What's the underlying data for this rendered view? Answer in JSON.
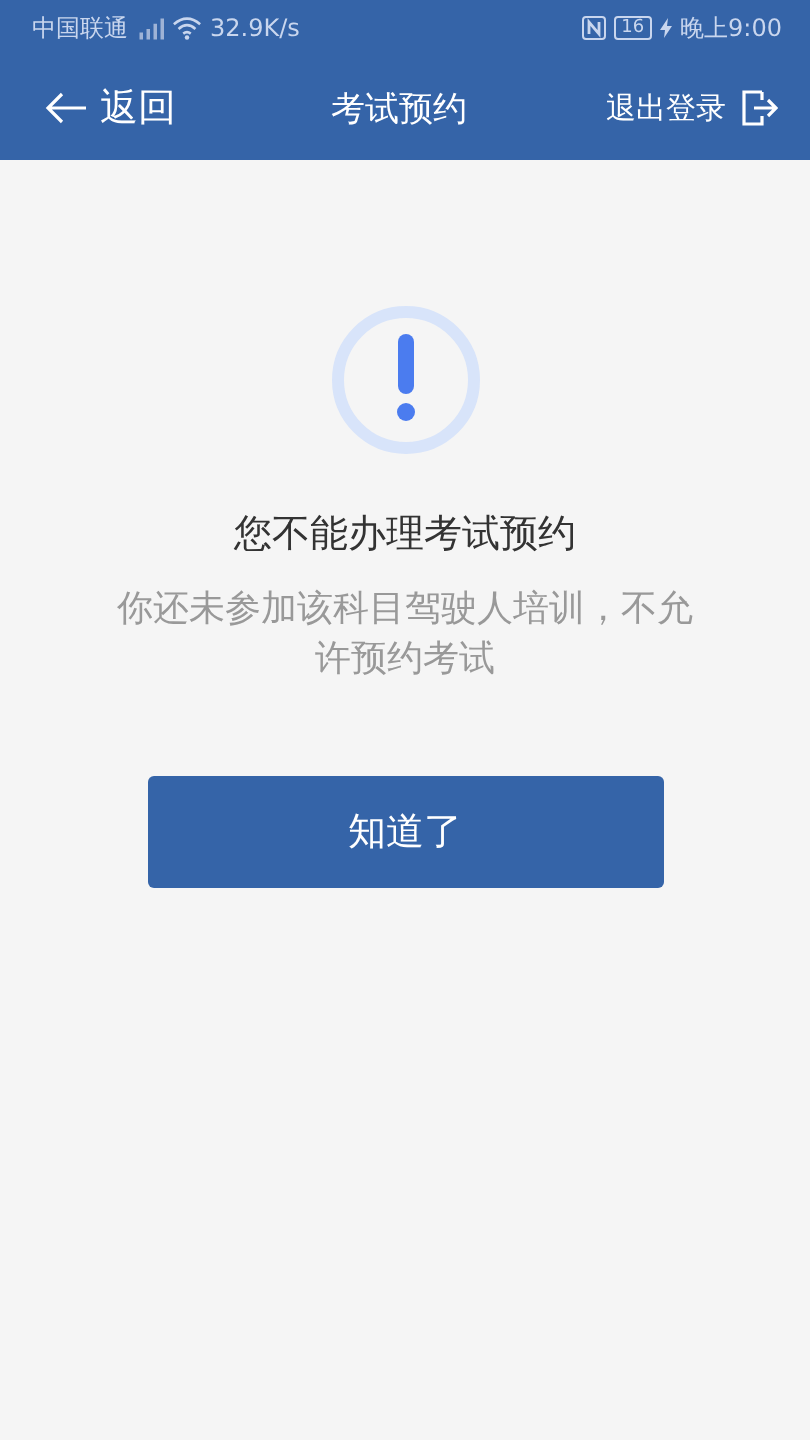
{
  "status_bar": {
    "carrier": "中国联通",
    "speed": "32.9K/s",
    "battery": "16",
    "time": "晚上9:00"
  },
  "nav": {
    "back": "返回",
    "title": "考试预约",
    "logout": "退出登录"
  },
  "notice": {
    "title": "您不能办理考试预约",
    "message": "你还未参加该科目驾驶人培训，不允许预约考试"
  },
  "buttons": [
    "知道了"
  ]
}
